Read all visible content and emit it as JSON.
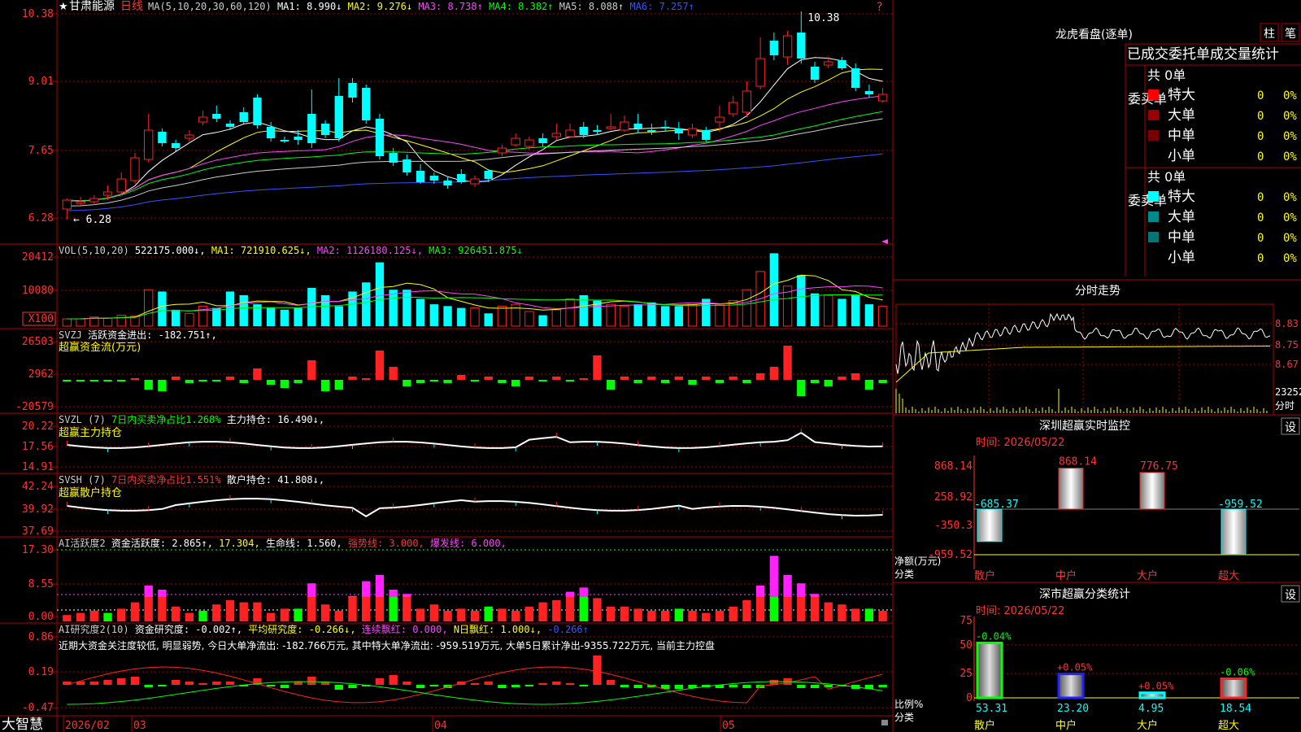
{
  "stock": {
    "name": "甘肃能源",
    "period": "日线",
    "star": "★"
  },
  "ma_header": {
    "label": "MA(5,10,20,30,60,120)",
    "items": [
      {
        "t": "MA1: 8.990↓",
        "c": "#ffffff"
      },
      {
        "t": "MA2: 9.276↓",
        "c": "#ffff00"
      },
      {
        "t": "MA3: 8.738↑",
        "c": "#ff44ff"
      },
      {
        "t": "MA4: 8.382↑",
        "c": "#00ff00"
      },
      {
        "t": "MA5: 8.088↑",
        "c": "#cccccc"
      },
      {
        "t": "MA6: 7.257↑",
        "c": "#3355ff"
      }
    ]
  },
  "price_axis": [
    "10.38",
    "9.01",
    "7.65",
    "6.28"
  ],
  "price_high": "10.38",
  "price_low": "6.28",
  "vol_header": [
    {
      "t": "VOL(5,10,20)",
      "c": "#cccccc"
    },
    {
      "t": "522175.000↓,",
      "c": "#ffffff"
    },
    {
      "t": "MA1: 721910.625↓,",
      "c": "#ffff00"
    },
    {
      "t": "MA2: 1126180.125↓,",
      "c": "#ff44ff"
    },
    {
      "t": "MA3: 926451.875↓",
      "c": "#00ff00"
    }
  ],
  "vol_axis": [
    "20412",
    "10080",
    "X100"
  ],
  "svzj": {
    "line1": [
      {
        "t": "SVZJ",
        "c": "#cccccc"
      },
      {
        "t": "活跃资金进出: -182.751↑,",
        "c": "#ffffff"
      }
    ],
    "line2": "超赢资金流(万元)",
    "axis": [
      "26503",
      "2962",
      "-20579"
    ]
  },
  "svzl": {
    "line1": [
      {
        "t": "SVZL (7)",
        "c": "#cccccc"
      },
      {
        "t": "7日内买卖净占比1.268%",
        "c": "#00ff00"
      },
      {
        "t": "主力持仓: 16.490↓,",
        "c": "#ffffff"
      }
    ],
    "line2": "超赢主力持仓",
    "axis": [
      "20.22",
      "17.56",
      "14.91"
    ]
  },
  "svsh": {
    "line1": [
      {
        "t": "SVSH (7)",
        "c": "#cccccc"
      },
      {
        "t": "7日内买卖净占比1.551%",
        "c": "#ff3333"
      },
      {
        "t": "散户持仓: 41.808↓,",
        "c": "#ffffff"
      }
    ],
    "line2": "超赢散户持仓",
    "axis": [
      "42.24",
      "39.92",
      "37.69"
    ]
  },
  "ai1": {
    "line1": [
      {
        "t": "AI活跃度2",
        "c": "#cccccc"
      },
      {
        "t": "资金活跃度: 2.865↑,",
        "c": "#ffffff"
      },
      {
        "t": "17.304,",
        "c": "#ffff00"
      },
      {
        "t": "生命线: 1.560,",
        "c": "#ffffff"
      },
      {
        "t": "强势线: 3.000,",
        "c": "#ff3333"
      },
      {
        "t": "爆发线: 6.000,",
        "c": "#ff44ff"
      }
    ],
    "axis": [
      "17.30",
      "8.55",
      "0.00"
    ]
  },
  "ai2": {
    "line1": [
      {
        "t": "AI研究度2(10)",
        "c": "#cccccc"
      },
      {
        "t": "资金研究度: -0.002↑,",
        "c": "#ffffff"
      },
      {
        "t": "平均研究度: -0.266↓,",
        "c": "#ffff00"
      },
      {
        "t": "连续飘红: 0.000,",
        "c": "#ff44ff"
      },
      {
        "t": "N日飘红: 1.000↓,",
        "c": "#ffff00"
      },
      {
        "t": "-0.266↑",
        "c": "#3355ff"
      }
    ],
    "line2": "近期大资金关注度较低, 明显弱势, 今日大单净流出: -182.766万元, 其中特大单净流出: -959.519万元, 大单5日累计净出-9355.722万元, 当前主力控盘",
    "axis": [
      "0.86",
      "0.19",
      "-0.47"
    ]
  },
  "date_axis": [
    "2026/02",
    "03",
    "04",
    "05"
  ],
  "brand": "大智慧",
  "lhb": {
    "title": "龙虎看盘(逐单)",
    "btn_zhu": "柱",
    "btn_bi": "笔",
    "header": "已成交委托单成交量统计",
    "buy_label": "委买单",
    "sell_label": "委卖单",
    "buy_total": "共 0单",
    "sell_total": "共 0单",
    "buy_rows": [
      {
        "name": "特大",
        "count": "0",
        "pct": "0%",
        "color": "#ff0000"
      },
      {
        "name": "大单",
        "count": "0",
        "pct": "0%",
        "color": "#990000"
      },
      {
        "name": "中单",
        "count": "0",
        "pct": "0%",
        "color": "#770000"
      },
      {
        "name": "小单",
        "count": "0",
        "pct": "0%",
        "color": ""
      }
    ],
    "sell_rows": [
      {
        "name": "特大",
        "count": "0",
        "pct": "0%",
        "color": "#00ffff"
      },
      {
        "name": "大单",
        "count": "0",
        "pct": "0%",
        "color": "#008b8b"
      },
      {
        "name": "中单",
        "count": "0",
        "pct": "0%",
        "color": "#007777"
      },
      {
        "name": "小单",
        "count": "0",
        "pct": "0%",
        "color": ""
      }
    ]
  },
  "intraday": {
    "title": "分时走势",
    "axis": [
      "8.83",
      "8.75",
      "8.67"
    ],
    "vol_label": "23252",
    "vol_unit": "分时"
  },
  "sz_monitor": {
    "title": "深圳超赢实时监控",
    "set": "设",
    "time": "时间: 2026/05/22",
    "axis": [
      "868.14",
      "258.92",
      "-350.3",
      "-959.52"
    ],
    "ylabel": "净额(万元)",
    "xlabel": "分类",
    "categories": [
      "散户",
      "中户",
      "大户",
      "超大"
    ],
    "values": [
      "-685.37",
      "868.14",
      "776.75",
      "-959.52"
    ]
  },
  "sz_stats": {
    "title": "深市超赢分类统计",
    "set": "设",
    "time": "时间: 2026/05/22",
    "axis": [
      "75",
      "50",
      "25",
      "0"
    ],
    "ylabel": "比例%",
    "xlabel": "分类",
    "categories": [
      "散户",
      "中户",
      "大户",
      "超大"
    ],
    "values": [
      "53.31",
      "23.20",
      "4.95",
      "18.54"
    ],
    "changes": [
      "-0.04%",
      "+0.05%",
      "+0.05%",
      "-0.06%"
    ]
  },
  "colors": {
    "up": "#ff2222",
    "down": "#00ffff",
    "green": "#00ff00",
    "grid": "#aa0000",
    "axis_text": "#ff3333",
    "title": "#ffffff"
  }
}
